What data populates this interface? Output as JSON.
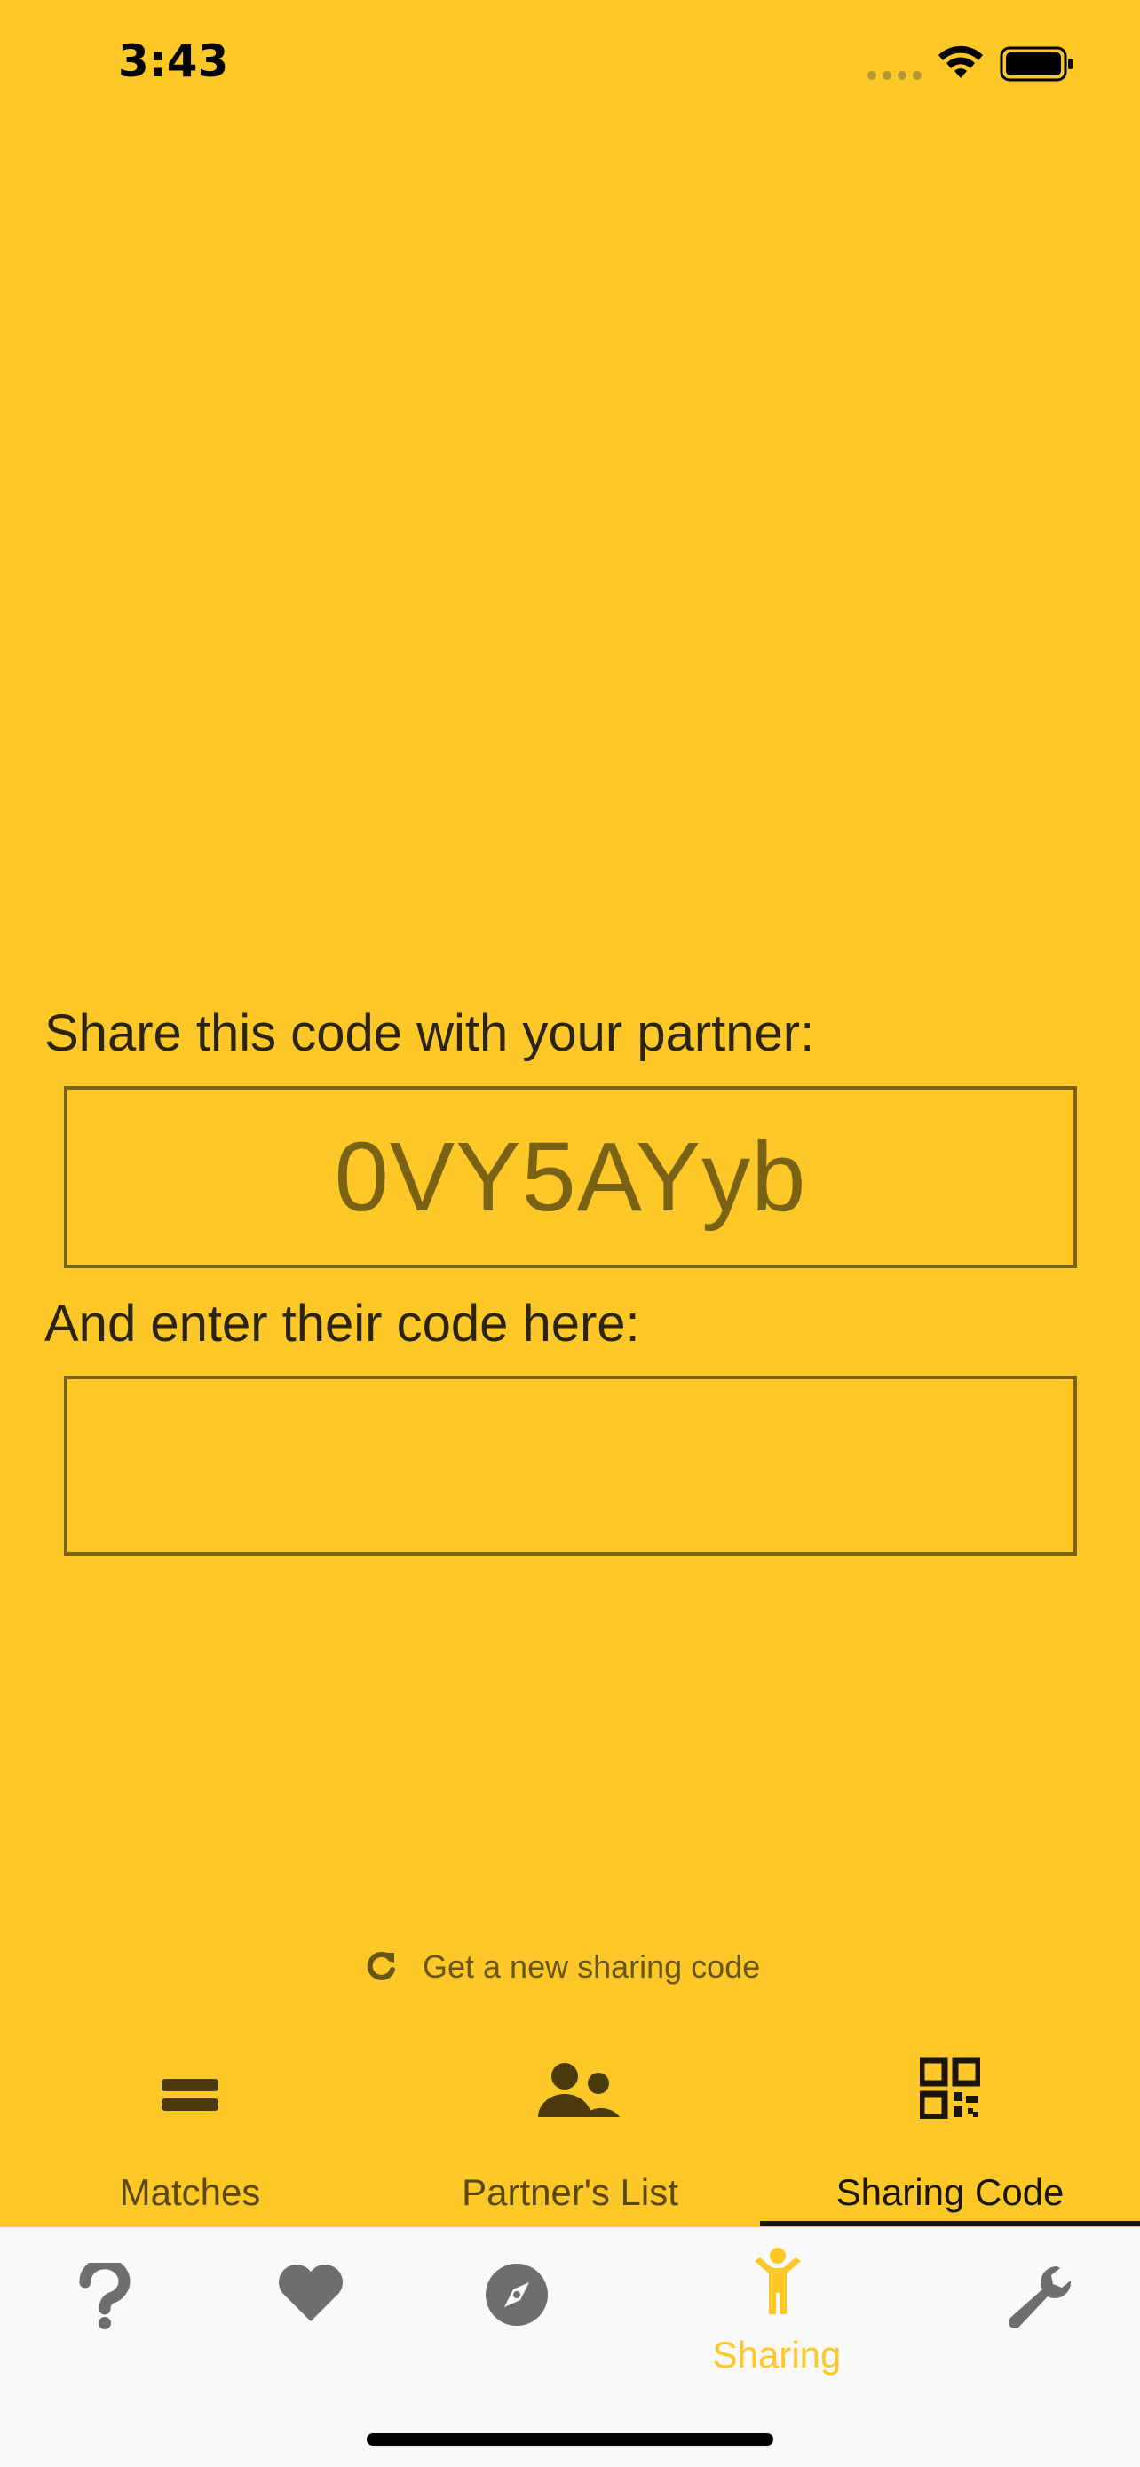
{
  "status_bar": {
    "time": "3:43"
  },
  "share": {
    "share_prompt": "Share this code with your partner:",
    "sharing_code": "0VY5AYyb",
    "enter_prompt": "And enter their code here:",
    "partner_code_value": "",
    "partner_code_placeholder": ""
  },
  "new_code": {
    "label": "Get a new sharing code",
    "icon": "refresh-icon"
  },
  "inner_tabs": [
    {
      "label": "Matches",
      "icon": "equals-icon"
    },
    {
      "label": "Partner's List",
      "icon": "users-icon"
    },
    {
      "label": "Sharing Code",
      "icon": "qr-code-icon",
      "active": true
    }
  ],
  "bottom_tabs": [
    {
      "label": "",
      "icon": "question-icon"
    },
    {
      "label": "",
      "icon": "heart-icon"
    },
    {
      "label": "",
      "icon": "compass-icon"
    },
    {
      "label": "Sharing",
      "icon": "person-raised-arms-icon",
      "active": true
    },
    {
      "label": "",
      "icon": "wrench-icon"
    }
  ],
  "colors": {
    "background": "#FEC828",
    "text_dark": "#2B2410",
    "code_text": "#7A6214",
    "bottom_bar_bg": "#F9F9F9",
    "inactive_icon": "#6E6E6E",
    "active_accent": "#FEC828"
  }
}
